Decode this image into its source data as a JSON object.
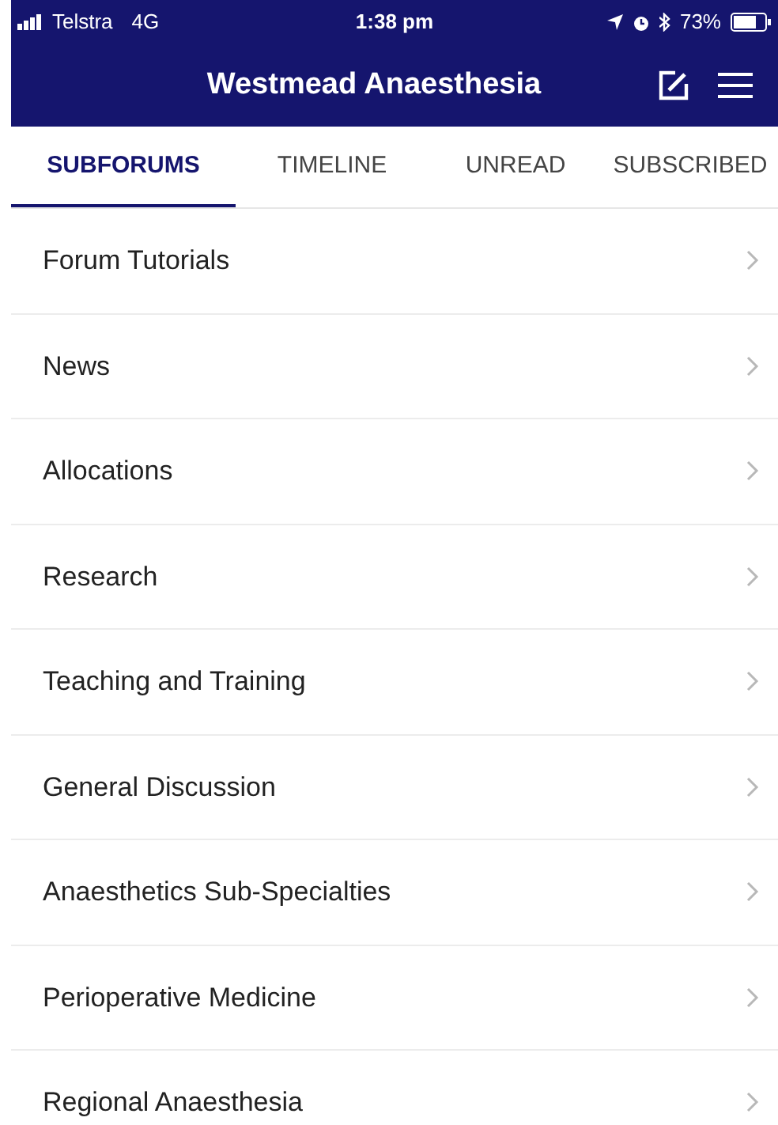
{
  "status_bar": {
    "carrier": "Telstra",
    "network": "4G",
    "time": "1:38 pm",
    "battery": "73%"
  },
  "nav": {
    "title": "Westmead Anaesthesia"
  },
  "tabs": [
    {
      "label": "SUBFORUMS",
      "selected": true
    },
    {
      "label": "TIMELINE",
      "selected": false
    },
    {
      "label": "UNREAD",
      "selected": false
    },
    {
      "label": "SUBSCRIBED",
      "selected": false
    }
  ],
  "subforums": [
    "Forum Tutorials",
    "News",
    "Allocations",
    "Research",
    "Teaching and Training",
    "General Discussion",
    "Anaesthetics Sub-Specialties",
    "Perioperative Medicine",
    "Regional Anaesthesia"
  ]
}
